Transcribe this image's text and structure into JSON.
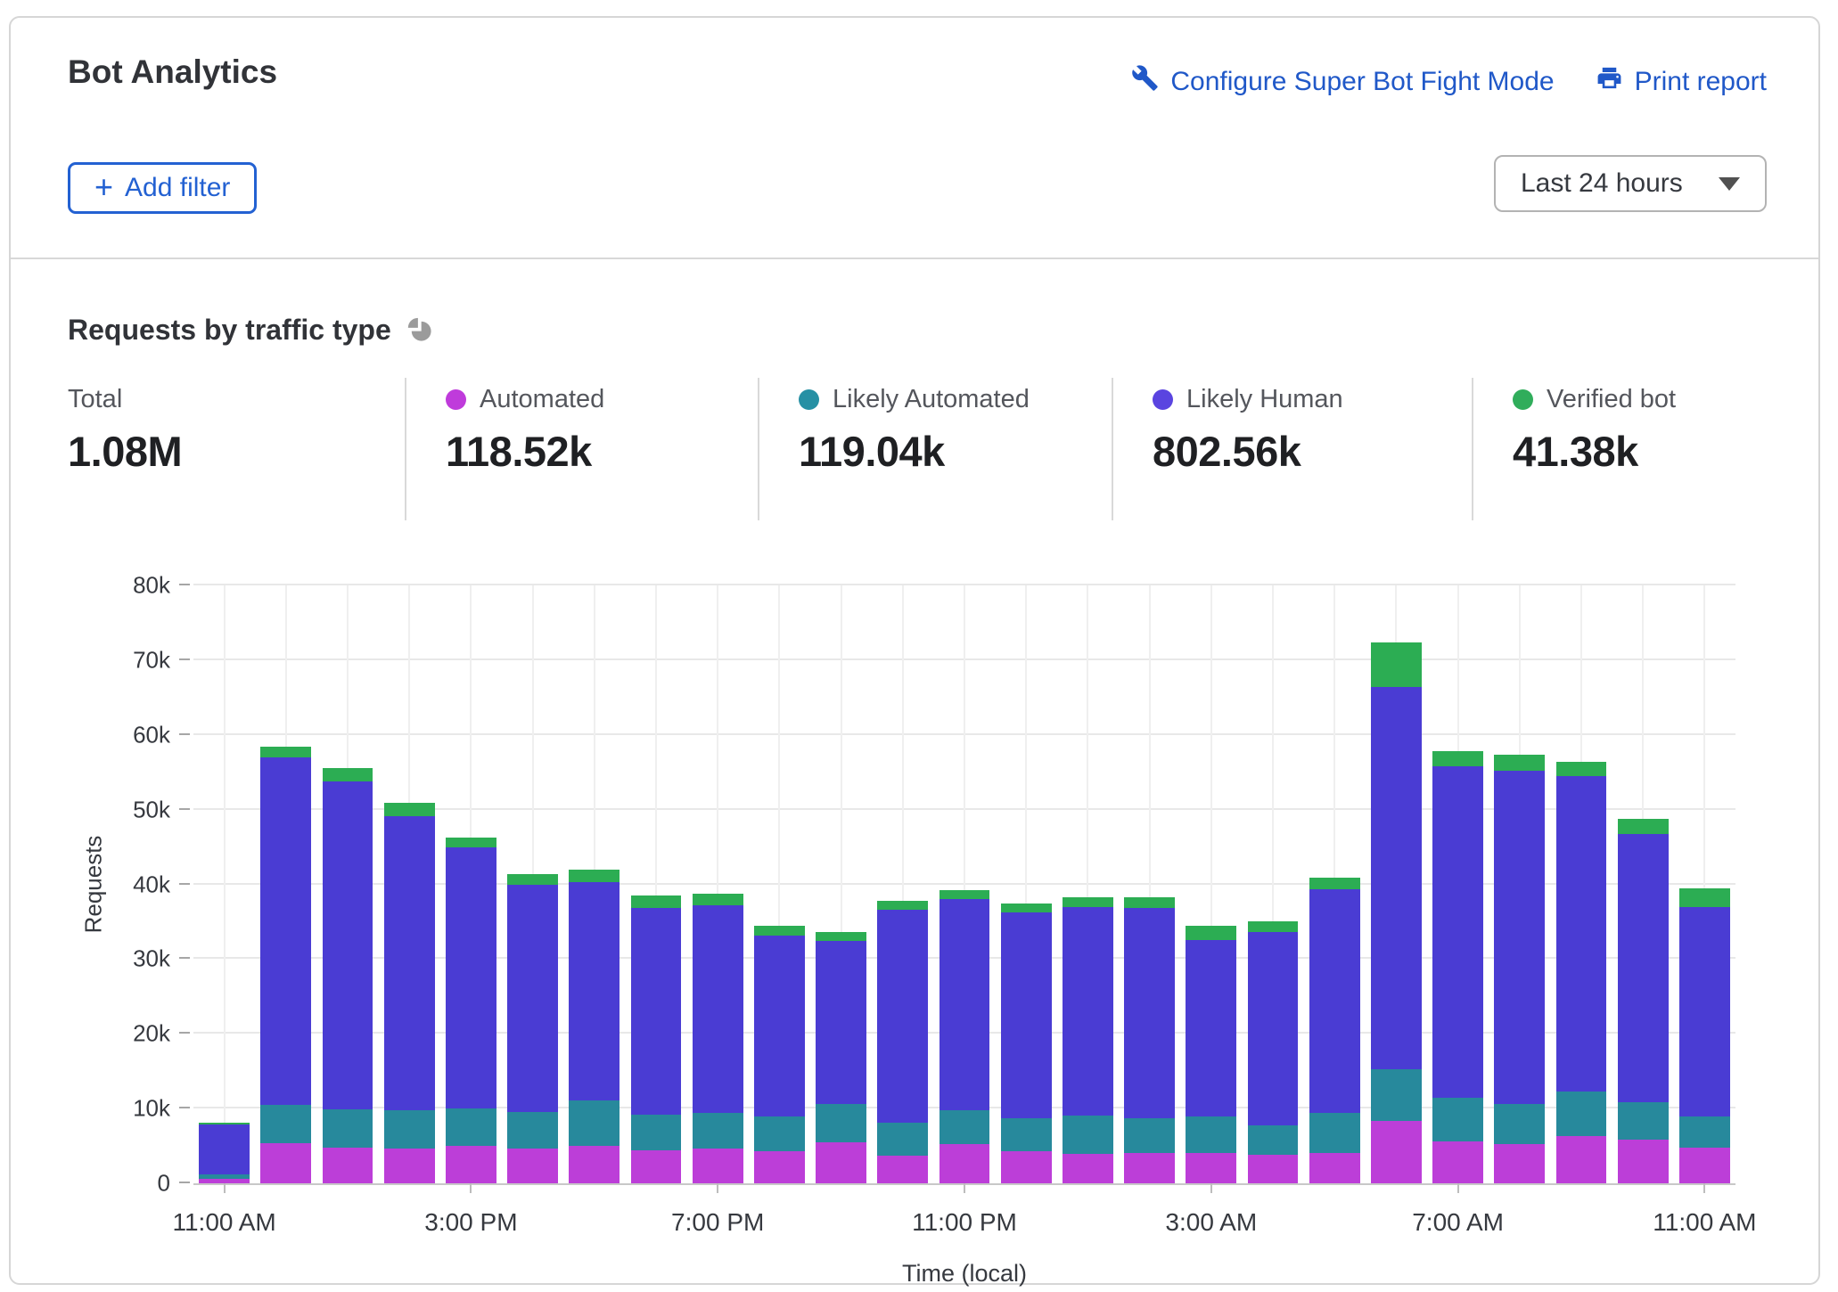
{
  "card": {
    "title": "Bot Analytics",
    "links": [
      {
        "label": "Configure Super Bot Fight Mode",
        "icon": "wrench-icon"
      },
      {
        "label": "Print report",
        "icon": "printer-icon"
      }
    ],
    "add_filter": {
      "label": "Add filter",
      "plus": "+"
    },
    "time_range": {
      "selected": "Last 24 hours"
    },
    "section_title": "Requests by traffic type"
  },
  "stats": [
    {
      "label": "Total",
      "value": "1.08M"
    },
    {
      "label": "Automated",
      "value": "118.52k",
      "dot_color": "#bf3bdb"
    },
    {
      "label": "Likely Automated",
      "value": "119.04k",
      "dot_color": "#2690a4"
    },
    {
      "label": "Likely Human",
      "value": "802.56k",
      "dot_color": "#5a44e0"
    },
    {
      "label": "Verified bot",
      "value": "41.38k",
      "dot_color": "#30ad5b"
    }
  ],
  "chart_data": {
    "type": "bar",
    "stacked": true,
    "title": "Requests by traffic type",
    "xlabel": "Time (local)",
    "ylabel": "Requests",
    "unit": "thousands of requests",
    "ylim": [
      0,
      80
    ],
    "yticks": [
      "0",
      "10k",
      "20k",
      "30k",
      "40k",
      "50k",
      "60k",
      "70k",
      "80k"
    ],
    "grid": true,
    "categories": [
      "11:00 AM",
      "12:00 PM",
      "1:00 PM",
      "2:00 PM",
      "3:00 PM",
      "4:00 PM",
      "5:00 PM",
      "6:00 PM",
      "7:00 PM",
      "8:00 PM",
      "9:00 PM",
      "10:00 PM",
      "11:00 PM",
      "12:00 AM",
      "1:00 AM",
      "2:00 AM",
      "3:00 AM",
      "4:00 AM",
      "5:00 AM",
      "6:00 AM",
      "7:00 AM",
      "8:00 AM",
      "9:00 AM",
      "10:00 AM",
      "11:00 AM"
    ],
    "x_tick_labels": [
      "11:00 AM",
      "3:00 PM",
      "7:00 PM",
      "11:00 PM",
      "3:00 AM",
      "7:00 AM",
      "11:00 AM"
    ],
    "x_tick_positions": [
      0,
      4,
      8,
      12,
      16,
      20,
      24
    ],
    "series": [
      {
        "name": "Automated",
        "color": "#bc3ed8",
        "values": [
          0.6,
          5.4,
          4.8,
          4.7,
          5.0,
          4.7,
          5.0,
          4.4,
          4.7,
          4.3,
          5.5,
          3.7,
          5.2,
          4.3,
          3.9,
          4.1,
          4.0,
          3.8,
          4.1,
          8.4,
          5.6,
          5.2,
          6.3,
          5.8,
          4.8
        ]
      },
      {
        "name": "Likely Automated",
        "color": "#27899c",
        "values": [
          0.6,
          5.1,
          5.1,
          5.1,
          5.0,
          4.9,
          6.1,
          4.8,
          4.7,
          4.6,
          5.1,
          4.4,
          4.6,
          4.4,
          5.2,
          4.6,
          5.0,
          4.0,
          5.3,
          6.9,
          5.9,
          5.4,
          6.0,
          5.0,
          4.1
        ]
      },
      {
        "name": "Likely Human",
        "color": "#4a3cd3",
        "values": [
          6.7,
          46.5,
          43.9,
          39.3,
          35.0,
          30.3,
          29.2,
          27.6,
          27.8,
          24.3,
          21.8,
          28.5,
          28.2,
          27.5,
          27.9,
          28.2,
          23.5,
          25.8,
          30.0,
          51.1,
          44.3,
          44.6,
          42.2,
          35.9,
          28.1
        ]
      },
      {
        "name": "Verified bot",
        "color": "#2cad53",
        "values": [
          0.2,
          1.4,
          1.8,
          1.8,
          1.3,
          1.5,
          1.7,
          1.7,
          1.6,
          1.2,
          1.2,
          1.2,
          1.2,
          1.3,
          1.3,
          1.4,
          2.0,
          1.5,
          1.5,
          6.0,
          2.0,
          2.1,
          1.9,
          2.1,
          2.5
        ]
      }
    ]
  }
}
